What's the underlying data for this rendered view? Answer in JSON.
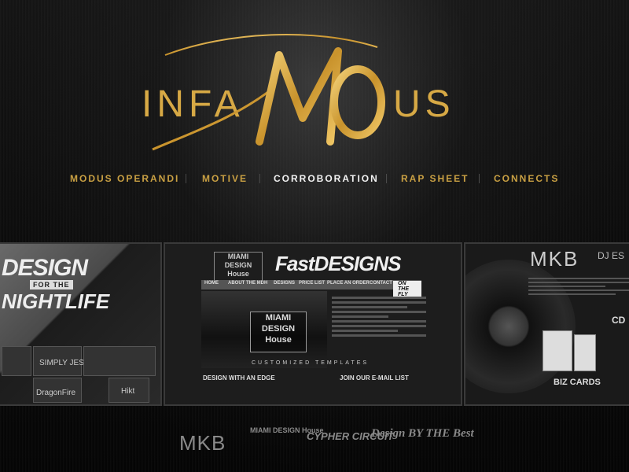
{
  "brand": {
    "left_text": "INFA",
    "monogram": "MO",
    "right_text": "US",
    "accent_color": "#d7a945"
  },
  "nav": {
    "items": [
      {
        "label": "MODUS OPERANDI",
        "active": false
      },
      {
        "label": "MOTIVE",
        "active": false
      },
      {
        "label": "CORROBORATION",
        "active": true
      },
      {
        "label": "RAP SHEET",
        "active": false
      },
      {
        "label": "CONNECTS",
        "active": false
      }
    ]
  },
  "gallery": {
    "panel1": {
      "title_line1": "DESIGN",
      "title_tag": "FOR THE",
      "title_line2": "NIGHTLIFE",
      "tiles": [
        "SIMPLY JESS",
        "DragonFire",
        "Hikt"
      ]
    },
    "panel2": {
      "header_logo": "MIAMI DESIGN House",
      "brand_title": "FastDESIGNS",
      "menu": [
        "HOME",
        "ABOUT THE MDH",
        "DESIGNS",
        "PRICE LIST",
        "PLACE AN ORDER",
        "CONTACT",
        "ON THE FLY"
      ],
      "hero_logo": "MIAMI DESIGN House",
      "hero_caption": "CUSTOMIZED TEMPLATES",
      "section_left": "DESIGN WITH AN EDGE",
      "section_right": "JOIN OUR E-MAIL LIST"
    },
    "panel3": {
      "logo": "MKB",
      "header_text": "DJ ES",
      "label_cd": "CD",
      "label_biz": "BIZ CARDS"
    }
  },
  "footer_logos": {
    "mkb": "MKB",
    "mdh": "MIAMI DESIGN House",
    "cypher": "CYPHER CIRCUIT",
    "dtb": "Design BY THE Best"
  }
}
